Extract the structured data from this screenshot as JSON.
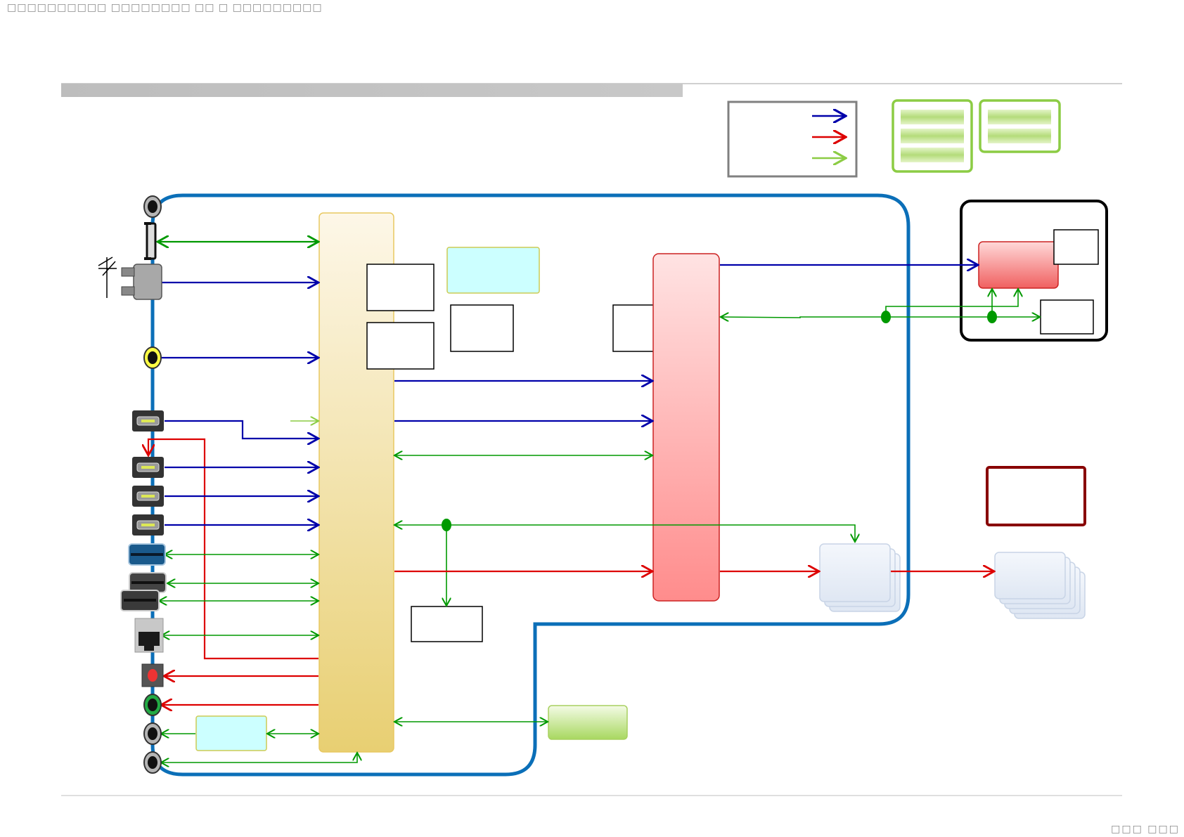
{
  "header": {
    "text": "□□□□□□□□□□ □□□□□□□□ □□ □ □□□□□□□□□"
  },
  "footer": {
    "page_text": "□□□ □□□"
  },
  "colors": {
    "video_arrow": "#0000aa",
    "audio_arrow": "#dd0000",
    "control_arrow": "#009900",
    "legend_control": "#8ccc44",
    "board_outline": "#0b6fb8",
    "main_block": "#e8d070",
    "decoder_block": "#ff8888",
    "module_outline": "#000000",
    "power_outline": "#880000"
  },
  "icons": [
    "rf-jack-icon",
    "satellite-connector-icon",
    "antenna-tuner-icon",
    "composite-jack-icon",
    "hdmi-port-icon",
    "usb-port-icon",
    "sd-card-slot-icon",
    "lan-port-icon",
    "optical-out-icon",
    "audio-jack-icon"
  ]
}
